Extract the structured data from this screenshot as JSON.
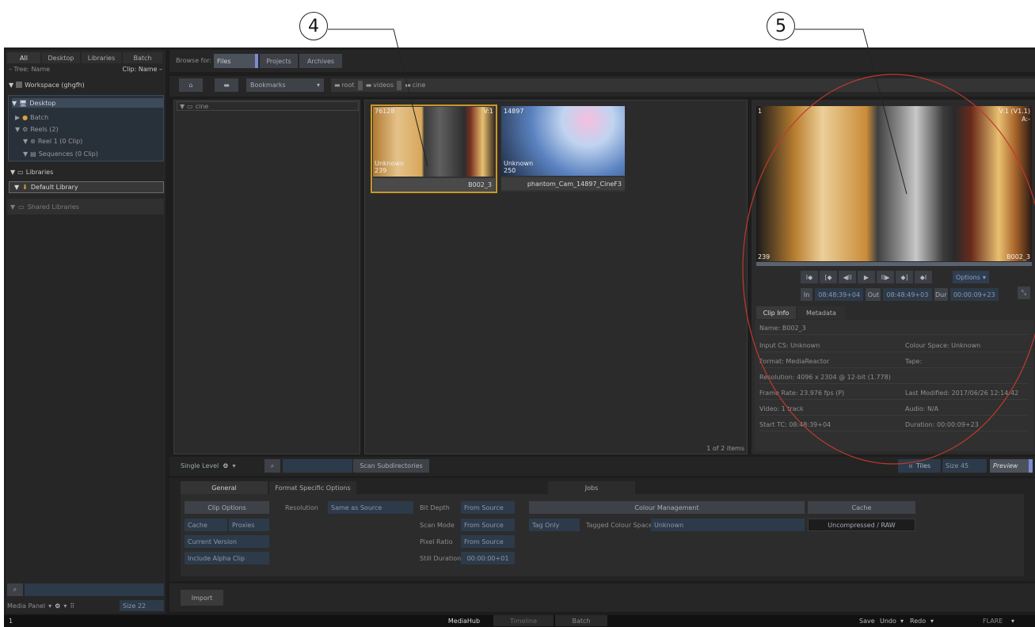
{
  "callouts": {
    "c4": "4",
    "c5": "5"
  },
  "left": {
    "tabs": [
      "All",
      "Desktop",
      "Libraries",
      "Batch"
    ],
    "tree_header_left": "– Tree: Name",
    "tree_header_right": "Clip: Name –",
    "workspace": "Workspace (ghgfh)",
    "desktop": "Desktop",
    "batch": "Batch",
    "reels": "Reels (2)",
    "reel1": "Reel 1 (0 Clip)",
    "sequences": "Sequences (0 Clip)",
    "libraries": "Libraries",
    "default_library": "Default Library",
    "shared_libraries": "Shared Libraries",
    "media_panel": "Media Panel",
    "size": "Size 22"
  },
  "browse": {
    "label": "Browse for:",
    "tabs": [
      "Files",
      "Projects",
      "Archives"
    ],
    "bookmarks": "Bookmarks",
    "path": [
      "root",
      "videos",
      "cine"
    ],
    "folder": "cine"
  },
  "thumbs": [
    {
      "name": "B002_3",
      "tl": "76128",
      "tr": "V:1",
      "bl1": "Unknown",
      "bl2": "239"
    },
    {
      "name": "phantom_Cam_14897_CineF3",
      "tl": "14897",
      "tr": "",
      "bl1": "Unknown",
      "bl2": "250"
    }
  ],
  "items_count": "1 of 2 items",
  "viewer": {
    "tl": "1",
    "tr1": "V:1 (V1.1)",
    "tr2": "A:-",
    "bl": "239",
    "br": "B002_3",
    "options": "Options",
    "in_label": "In",
    "in_val": "08:48:39+04",
    "out_label": "Out",
    "out_val": "08:48:49+03",
    "dur_label": "Dur",
    "dur_val": "00:00:09+23",
    "transport": [
      "I◆",
      "[◆",
      "◀II",
      "▶",
      "II▶",
      "◆]",
      "◆I"
    ]
  },
  "clip_info": {
    "tabs": [
      "Clip Info",
      "Metadata"
    ],
    "name": "Name: B002_3",
    "input_cs": "Input CS: Unknown",
    "colour_space": "Colour Space: Unknown",
    "format": "Format: MediaReactor",
    "tape": "Tape:",
    "resolution": "Resolution: 4096 x 2304 @ 12-bit (1.778)",
    "frame_rate": "Frame Rate: 23.976 fps (P)",
    "last_modified": "Last Modified: 2017/06/26 12:14:42",
    "video": "Video: 1 track",
    "audio": "Audio: N/A",
    "start_tc": "Start TC: 08:48:39+04",
    "duration": "Duration: 00:00:09+23"
  },
  "toolbar": {
    "single_level": "Single Level",
    "scan": "Scan Subdirectories",
    "tiles": "Tiles",
    "size": "Size 45",
    "preview": "Preview"
  },
  "options": {
    "tabs": [
      "General",
      "Format Specific Options",
      "Jobs"
    ],
    "clip_options": "Clip Options",
    "cache": "Cache",
    "proxies": "Proxies",
    "current_version": "Current Version",
    "include_alpha": "Include Alpha Clip",
    "resolution_label": "Resolution",
    "resolution_val": "Same as Source",
    "bit_depth_label": "Bit Depth",
    "bit_depth_val": "From Source",
    "scan_mode_label": "Scan Mode",
    "scan_mode_val": "From Source",
    "pixel_ratio_label": "Pixel Ratio",
    "pixel_ratio_val": "From Source",
    "still_label": "Still Duration",
    "still_val": "00:00:00+01",
    "colour_mgmt": "Colour Management",
    "tag_only": "Tag Only",
    "tagged_cs_label": "Tagged Colour Space",
    "tagged_cs_val": "Unknown",
    "cache_header": "Cache",
    "cache_val": "Uncompressed / RAW",
    "import": "Import"
  },
  "bottom": {
    "left": "1",
    "tabs": [
      "MediaHub",
      "Timeline",
      "Batch"
    ],
    "save": "Save",
    "undo": "Undo",
    "redo": "Redo",
    "flare": "FLARE"
  }
}
